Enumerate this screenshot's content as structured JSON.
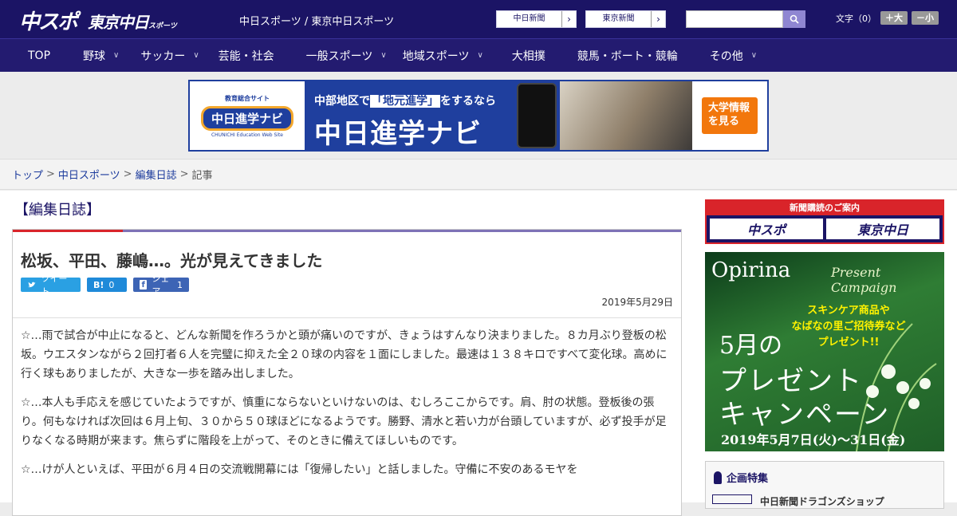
{
  "header": {
    "logo_main": "中スポ",
    "logo_sub": "東京中日",
    "logo_sub_small": "スポーツ",
    "sites": "中日スポーツ / 東京中日スポーツ",
    "paper_links": [
      "中日新聞",
      "東京新聞"
    ],
    "search_placeholder": "",
    "fontsize_label": "文字（0）",
    "fontsize_plus": "＋大",
    "fontsize_minus": "－小"
  },
  "nav": [
    "TOP",
    "野球",
    "サッカー",
    "芸能・社会",
    "一般スポーツ",
    "地域スポーツ",
    "大相撲",
    "競馬・ボート・競輪",
    "その他"
  ],
  "nav_dropdown": [
    false,
    true,
    true,
    false,
    true,
    true,
    false,
    false,
    true
  ],
  "banner": {
    "edu_label": "教育総合サイト",
    "navi_label": "中日進学ナビ",
    "web_site": "CHUNICHI Education Web Site",
    "headline_pre": "中部地区で",
    "headline_hl": "「地元進学」",
    "headline_post": "をするなら",
    "title": "中日進学ナビ",
    "cta": "大学情報を見る"
  },
  "breadcrumb": [
    "トップ",
    "中日スポーツ",
    "編集日誌",
    "記事"
  ],
  "article": {
    "category": "【編集日誌】",
    "title": "松坂、平田、藤嶋…。光が見えてきました",
    "share": {
      "tweet": "ツイート",
      "hatena_count": "0",
      "facebook": "シェア",
      "facebook_count": "1"
    },
    "date": "2019年5月29日",
    "paragraphs": [
      "☆…雨で試合が中止になると、どんな新聞を作ろうかと頭が痛いのですが、きょうはすんなり決まりました。８カ月ぶり登板の松坂。ウエスタンながら２回打者６人を完璧に抑えた全２０球の内容を１面にしました。最速は１３８キロですべて変化球。高めに行く球もありましたが、大きな一歩を踏み出しました。",
      "☆…本人も手応えを感じていたようですが、慎重にならないといけないのは、むしろここからです。肩、肘の状態。登板後の張り。何もなければ次回は６月上旬、３０から５０球ほどになるようです。勝野、清水と若い力が台頭していますが、必ず投手が足りなくなる時期が来ます。焦らずに階段を上がって、そのときに備えてほしいものです。",
      "☆…けが人といえば、平田が６月４日の交流戦開幕には「復帰したい」と話しました。守備に不安のあるモヤを"
    ]
  },
  "sidebar": {
    "subscribe_header": "新聞購読のご案内",
    "subscribe_logos": [
      "中スポ",
      "東京中日"
    ],
    "ad": {
      "brand": "Opirina",
      "campaign": "Present Campaign",
      "lines": [
        "スキンケア商品や",
        "なばなの里ご招待券など",
        "プレゼント!!"
      ],
      "month": "5月の",
      "big1": "プレゼント",
      "big2": "キャンペーン",
      "dates": "2019年5月7日(火)〜31日(金)"
    },
    "feature_title": "企画特集",
    "feature_item": "中日新聞ドラゴンズショップ"
  }
}
